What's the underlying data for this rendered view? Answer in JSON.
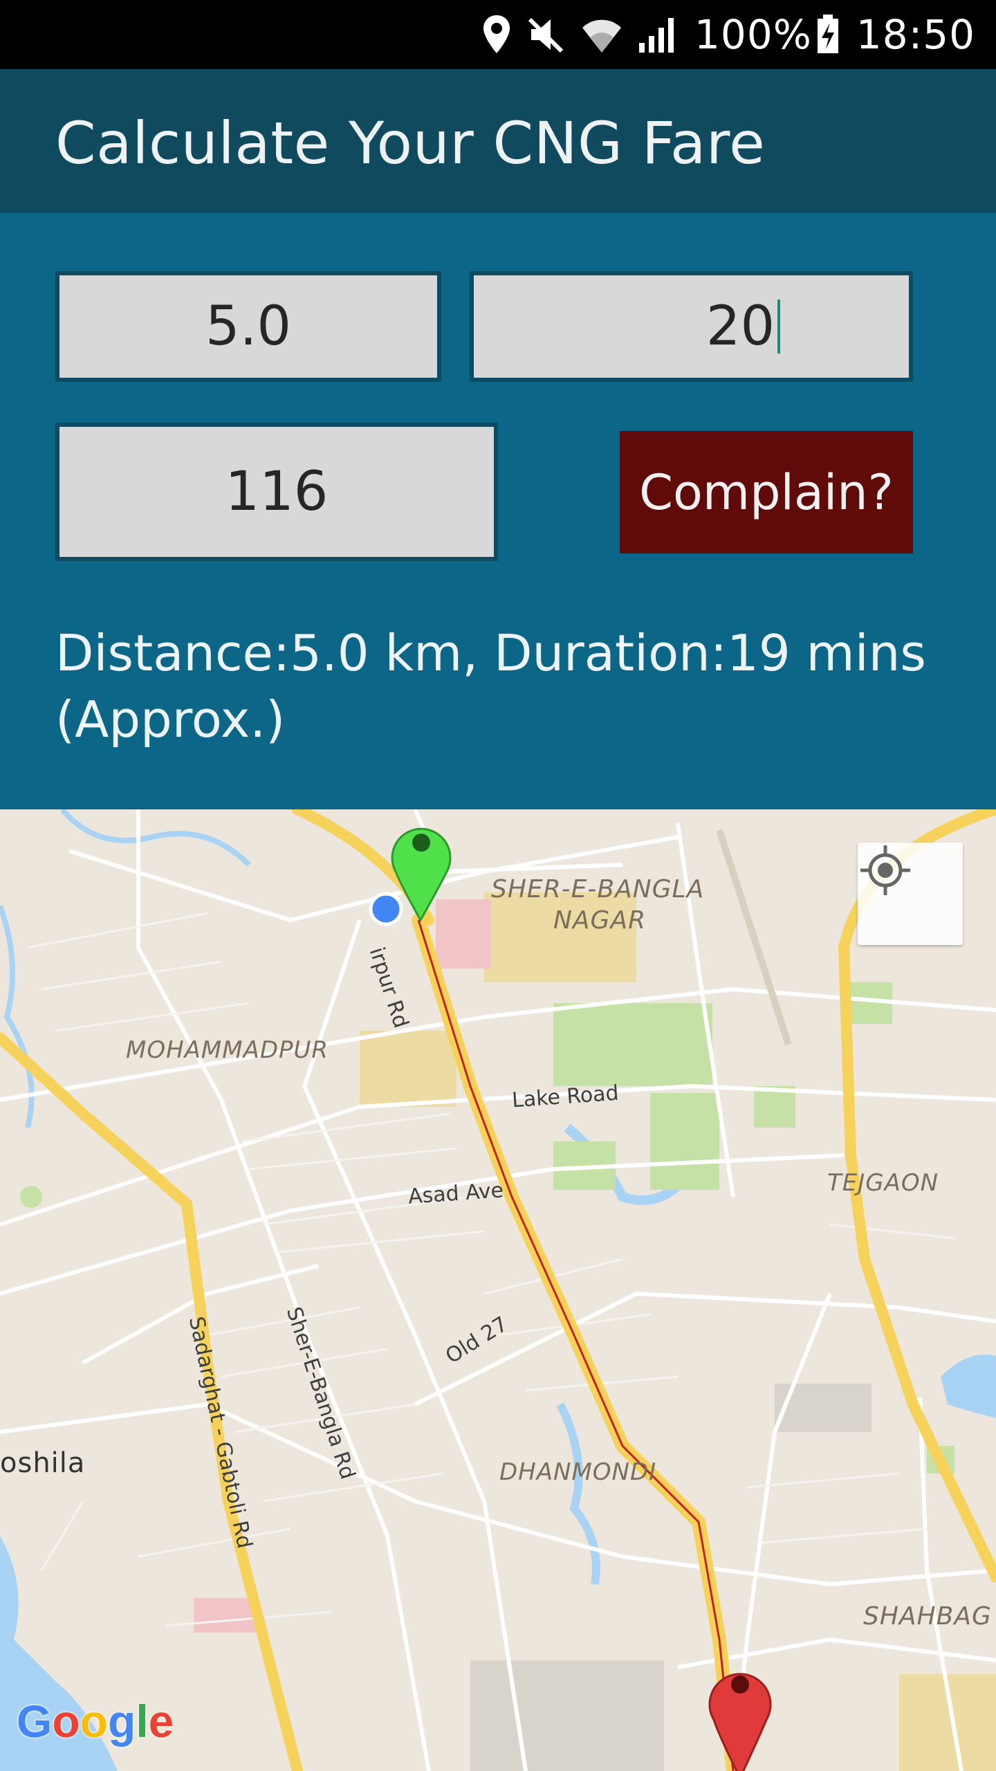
{
  "status_bar": {
    "battery": "100%",
    "time": "18:50",
    "icons": [
      "location-icon",
      "mute-icon",
      "wifi-icon",
      "signal-icon",
      "battery-charging-icon"
    ]
  },
  "app_bar": {
    "title": "Calculate Your CNG Fare"
  },
  "form": {
    "distance_value": "5.0",
    "time_value": "20",
    "fare_value": "116",
    "complain_label": "Complain?",
    "summary": "Distance:5.0 km, Duration:19 mins (Approx.)"
  },
  "map": {
    "labels": {
      "sher_e_bangla_1": "SHER-E-BANGLA",
      "sher_e_bangla_2": "NAGAR",
      "mohammadpur": "MOHAMMADPUR",
      "tejgaon": "TEJGAON",
      "dhanmondi": "DHANMONDI",
      "shahbag": "SHAHBAG",
      "oshila": "oshila"
    },
    "roads": {
      "mirpur_rd": "irpur Rd",
      "lake_road": "Lake Road",
      "asad_ave": "Asad Ave",
      "old_27": "Old 27",
      "sher_e_bangla_rd": "Sher-E-Bangla Rd",
      "sadarghat_rd": "Sadarghat - Gabtoli Rd"
    },
    "logo": [
      "G",
      "o",
      "o",
      "g",
      "l",
      "e"
    ],
    "colors": {
      "start_marker": "#4fe04a",
      "end_marker": "#e03a3a",
      "route": "#c8201e",
      "major_road": "#f6d25a",
      "water": "#a8d3f5",
      "park": "#c5e1a5"
    }
  }
}
